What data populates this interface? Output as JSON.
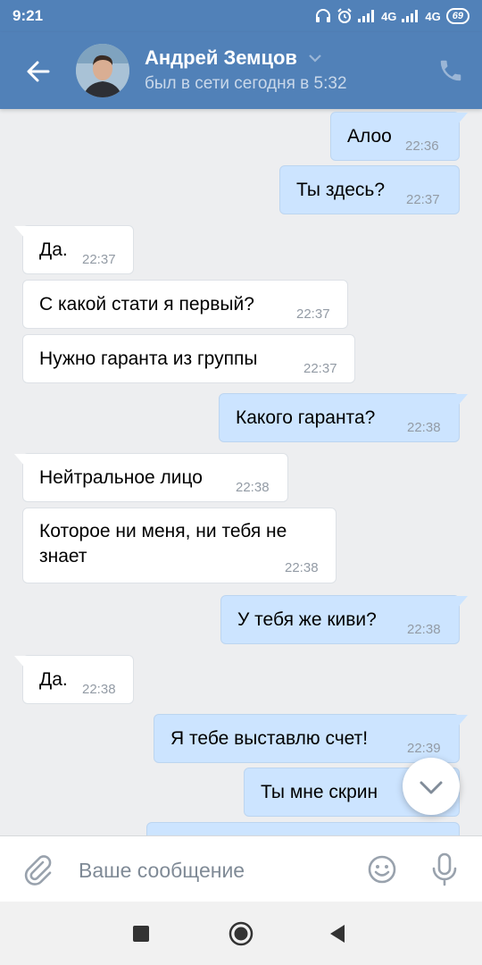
{
  "status_bar": {
    "time": "9:21",
    "network1": "4G",
    "network2": "4G",
    "battery": "69"
  },
  "header": {
    "contact_name": "Андрей Земцов",
    "contact_status": "был в сети сегодня в 5:32"
  },
  "messages": [
    {
      "dir": "out",
      "text": "Алоо",
      "time": "22:36"
    },
    {
      "dir": "out",
      "text": "Ты здесь?",
      "time": "22:37"
    },
    {
      "dir": "in",
      "text": "Да.",
      "time": "22:37"
    },
    {
      "dir": "in",
      "text": "С какой стати я первый?",
      "time": "22:37"
    },
    {
      "dir": "in",
      "text": "Нужно гаранта из группы",
      "time": "22:37"
    },
    {
      "dir": "out",
      "text": "Какого гаранта?",
      "time": "22:38"
    },
    {
      "dir": "in",
      "text": "Нейтральное лицо",
      "time": "22:38"
    },
    {
      "dir": "in",
      "text": "Которое ни меня, ни тебя не\nзнает",
      "time": "22:38"
    },
    {
      "dir": "out",
      "text": "У тебя же киви?",
      "time": "22:38"
    },
    {
      "dir": "in",
      "text": "Да.",
      "time": "22:38"
    },
    {
      "dir": "out",
      "text": "Я тебе выставлю счет!",
      "time": "22:39"
    },
    {
      "dir": "out",
      "text": "Ты мне скрин",
      "time": ""
    },
    {
      "dir": "out",
      "text": "",
      "time": ""
    }
  ],
  "input": {
    "placeholder": "Ваше сообщение",
    "value": ""
  },
  "colors": {
    "header_bg": "#5181b8",
    "outgoing_bubble": "#cce4ff",
    "incoming_bubble": "#ffffff",
    "chat_bg": "#edeef0"
  }
}
